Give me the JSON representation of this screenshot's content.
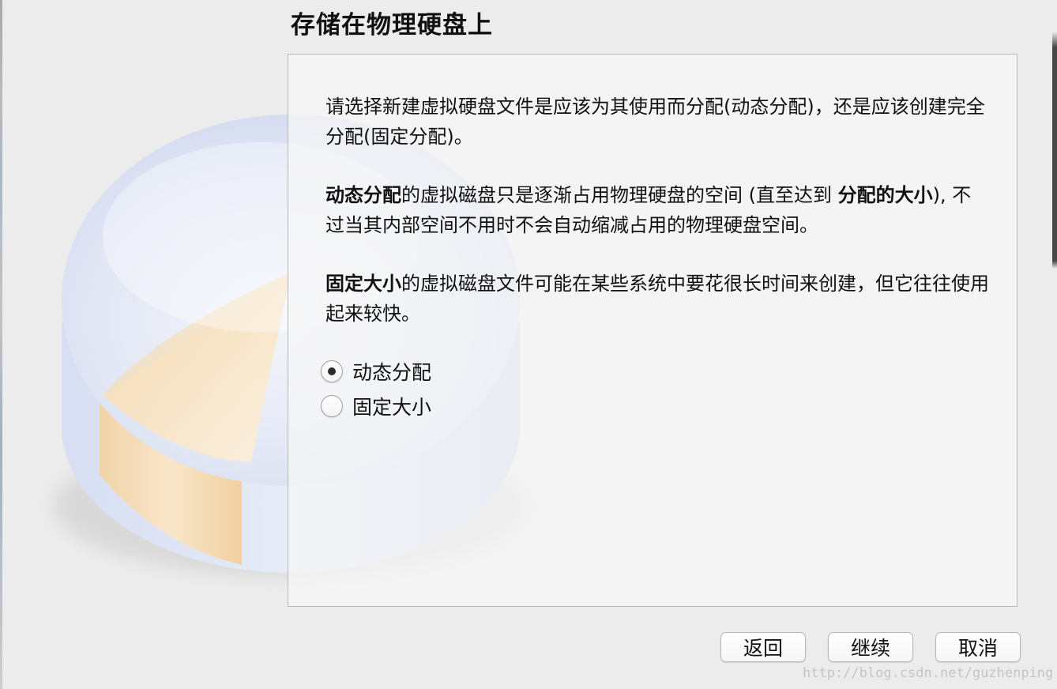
{
  "title": "存储在物理硬盘上",
  "description": {
    "para1": "请选择新建虚拟硬盘文件是应该为其使用而分配(动态分配)，还是应该创建完全分配(固定分配)。",
    "para2_bold1": "动态分配",
    "para2_text1": "的虚拟磁盘只是逐渐占用物理硬盘的空间 (直至达到 ",
    "para2_bold2": "分配的大小",
    "para2_text2": "), 不过当其内部空间不用时不会自动缩减占用的物理硬盘空间。",
    "para3_bold": "固定大小",
    "para3_text": "的虚拟磁盘文件可能在某些系统中要花很长时间来创建，但它往往使用起来较快。"
  },
  "options": [
    {
      "label": "动态分配",
      "selected": true
    },
    {
      "label": "固定大小",
      "selected": false
    }
  ],
  "buttons": {
    "back": "返回",
    "continue": "继续",
    "cancel": "取消"
  },
  "watermark": "http://blog.csdn.net/guzhenping",
  "colors": {
    "disk_blue": "#c9d3ee",
    "disk_orange": "#f6d7a6",
    "panel_bg": "#f7f7f7"
  }
}
